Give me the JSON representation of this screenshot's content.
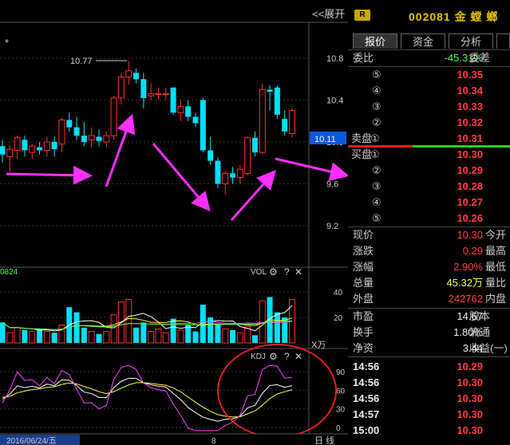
{
  "topbar": {
    "expand_label": "<<展开",
    "star": "*"
  },
  "stock": {
    "badge": "R",
    "code": "002081",
    "name": "金 螳 螂"
  },
  "tabs": [
    {
      "label": "报价"
    },
    {
      "label": "资金"
    },
    {
      "label": "分析"
    }
  ],
  "order_ratio": {
    "label": "委比",
    "value": "-45.31%",
    "label2": "委差"
  },
  "sell_side_label": "卖盘",
  "buy_side_label": "买盘",
  "sell_levels": [
    {
      "level": "⑤",
      "price": "10.35"
    },
    {
      "level": "④",
      "price": "10.34"
    },
    {
      "level": "③",
      "price": "10.33"
    },
    {
      "level": "②",
      "price": "10.32"
    },
    {
      "level": "①",
      "price": "10.31"
    }
  ],
  "buy_levels": [
    {
      "level": "①",
      "price": "10.30"
    },
    {
      "level": "②",
      "price": "10.29"
    },
    {
      "level": "③",
      "price": "10.28"
    },
    {
      "level": "④",
      "price": "10.27"
    },
    {
      "level": "⑤",
      "price": "10.26"
    }
  ],
  "quote": [
    {
      "label": "现价",
      "value": "10.30",
      "label2": "今开",
      "color": "red"
    },
    {
      "label": "涨跌",
      "value": "0.29",
      "label2": "最高",
      "color": "red"
    },
    {
      "label": "涨幅",
      "value": "2.90%",
      "label2": "最低",
      "color": "red"
    },
    {
      "label": "总量",
      "value": "45.32万",
      "label2": "量比",
      "color": "yellow"
    },
    {
      "label": "外盘",
      "value": "242762",
      "label2": "内盘",
      "color": "red"
    }
  ],
  "fundamentals": [
    {
      "label": "市盈",
      "value": "14.67",
      "label2": "股本"
    },
    {
      "label": "换手",
      "value": "1.80%",
      "label2": "流通"
    },
    {
      "label": "净资",
      "value": "3.44",
      "label2": "收益(一)"
    }
  ],
  "ticks": [
    {
      "time": "14:56",
      "price": "10.29"
    },
    {
      "time": "14:56",
      "price": "10.30"
    },
    {
      "time": "14:56",
      "price": "10.30"
    },
    {
      "time": "14:57",
      "price": "10.30"
    },
    {
      "time": "15:00",
      "price": "10.30"
    }
  ],
  "chart_data": {
    "type": "candlestick",
    "price_axis_ticks": [
      "10.8",
      "10.4",
      "10.0",
      "9.6",
      "9.2"
    ],
    "current_price_label": "10.11",
    "high_annotation": "10.77",
    "candles": [
      {
        "o": 9.96,
        "h": 10.02,
        "l": 9.8,
        "c": 9.88
      },
      {
        "o": 9.86,
        "h": 9.97,
        "l": 9.72,
        "c": 9.93
      },
      {
        "o": 9.92,
        "h": 10.06,
        "l": 9.84,
        "c": 10.04
      },
      {
        "o": 10.02,
        "h": 10.06,
        "l": 9.86,
        "c": 9.92
      },
      {
        "o": 9.9,
        "h": 9.98,
        "l": 9.84,
        "c": 9.96
      },
      {
        "o": 9.95,
        "h": 10.0,
        "l": 9.88,
        "c": 9.92
      },
      {
        "o": 9.92,
        "h": 10.05,
        "l": 9.86,
        "c": 10.0
      },
      {
        "o": 10.0,
        "h": 10.05,
        "l": 9.86,
        "c": 9.93
      },
      {
        "o": 9.98,
        "h": 10.23,
        "l": 9.9,
        "c": 10.21
      },
      {
        "o": 10.21,
        "h": 10.28,
        "l": 10.1,
        "c": 10.14
      },
      {
        "o": 10.14,
        "h": 10.24,
        "l": 10.02,
        "c": 10.06
      },
      {
        "o": 10.06,
        "h": 10.19,
        "l": 9.96,
        "c": 10.0
      },
      {
        "o": 10.02,
        "h": 10.14,
        "l": 9.95,
        "c": 10.06
      },
      {
        "o": 10.05,
        "h": 10.12,
        "l": 9.96,
        "c": 10.01
      },
      {
        "o": 10.0,
        "h": 10.1,
        "l": 9.95,
        "c": 10.06
      },
      {
        "o": 10.06,
        "h": 10.44,
        "l": 10.02,
        "c": 10.42
      },
      {
        "o": 10.42,
        "h": 10.66,
        "l": 10.36,
        "c": 10.62
      },
      {
        "o": 10.62,
        "h": 10.77,
        "l": 10.55,
        "c": 10.68
      },
      {
        "o": 10.66,
        "h": 10.7,
        "l": 10.56,
        "c": 10.6
      },
      {
        "o": 10.6,
        "h": 10.66,
        "l": 10.32,
        "c": 10.42
      },
      {
        "o": 10.44,
        "h": 10.56,
        "l": 10.4,
        "c": 10.46
      },
      {
        "o": 10.46,
        "h": 10.52,
        "l": 10.4,
        "c": 10.46
      },
      {
        "o": 10.46,
        "h": 10.52,
        "l": 10.4,
        "c": 10.46
      },
      {
        "o": 10.52,
        "h": 10.52,
        "l": 10.26,
        "c": 10.28
      },
      {
        "o": 10.28,
        "h": 10.4,
        "l": 10.2,
        "c": 10.34
      },
      {
        "o": 10.34,
        "h": 10.4,
        "l": 10.2,
        "c": 10.24
      },
      {
        "o": 10.24,
        "h": 10.28,
        "l": 10.14,
        "c": 10.18
      },
      {
        "o": 10.4,
        "h": 10.42,
        "l": 9.9,
        "c": 9.92
      },
      {
        "o": 9.92,
        "h": 10.05,
        "l": 9.78,
        "c": 9.82
      },
      {
        "o": 9.82,
        "h": 9.85,
        "l": 9.56,
        "c": 9.6
      },
      {
        "o": 9.6,
        "h": 9.72,
        "l": 9.5,
        "c": 9.7
      },
      {
        "o": 9.7,
        "h": 9.76,
        "l": 9.6,
        "c": 9.66
      },
      {
        "o": 9.66,
        "h": 9.78,
        "l": 9.6,
        "c": 9.74
      },
      {
        "o": 9.7,
        "h": 10.05,
        "l": 9.68,
        "c": 10.04
      },
      {
        "o": 10.04,
        "h": 10.1,
        "l": 9.86,
        "c": 9.9
      },
      {
        "o": 9.9,
        "h": 10.56,
        "l": 9.88,
        "c": 10.5
      },
      {
        "o": 10.5,
        "h": 10.54,
        "l": 10.3,
        "c": 10.48
      },
      {
        "o": 10.52,
        "h": 10.54,
        "l": 10.22,
        "c": 10.26
      },
      {
        "o": 10.22,
        "h": 10.3,
        "l": 10.06,
        "c": 10.1
      },
      {
        "o": 10.08,
        "h": 10.32,
        "l": 10.04,
        "c": 10.3
      }
    ],
    "volume_panel": {
      "title": "VOL",
      "unit": "X万",
      "left_label": "0824",
      "axis_ticks": [
        "40",
        "20"
      ],
      "values": [
        16,
        8,
        12,
        10,
        9,
        11,
        9,
        8,
        14,
        28,
        24,
        12,
        9,
        7,
        9,
        22,
        32,
        34,
        12,
        16,
        9,
        11,
        8,
        19,
        10,
        14,
        9,
        30,
        20,
        15,
        11,
        10,
        8,
        13,
        6,
        33,
        36,
        24,
        20,
        34
      ]
    },
    "kdj_panel": {
      "title": "KDJ",
      "axis_ticks": [
        "90",
        "60",
        "30",
        "0"
      ]
    },
    "date_label": "2016/06/24/五",
    "x_label_mid": "8",
    "period_label": "日 线"
  }
}
